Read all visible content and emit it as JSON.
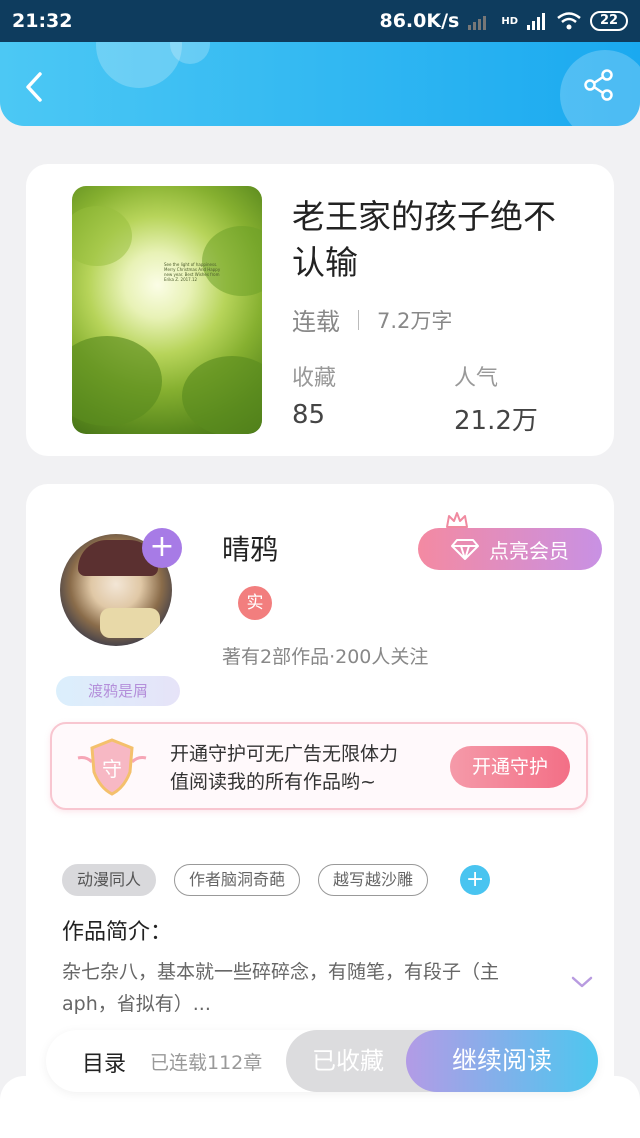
{
  "status_bar": {
    "time": "21:32",
    "network_speed": "86.0K/s",
    "network_type": "HD",
    "battery": "22",
    "icons": [
      "signal-icon",
      "wifi-icon",
      "battery-icon"
    ]
  },
  "header": {
    "back_icon": "back-arrow-icon",
    "share_icon": "share-icon",
    "accent_color": "#1aa9f0"
  },
  "book": {
    "title": "老王家的孩子绝不认输",
    "status": "连载",
    "word_count": "7.2万字",
    "collect_label": "收藏",
    "collect_value": "85",
    "popularity_label": "人气",
    "popularity_value": "21.2万",
    "cover_text": "See the light of happiness. Merry Christmas And Happy new year. Best Wishes from Erika Z. 2017.12"
  },
  "author": {
    "name": "晴鸦",
    "verified_label": "实",
    "stats": "著有2部作品·200人关注",
    "badge": "渡鸦是屑",
    "vip_label": "点亮会员"
  },
  "guard": {
    "icon_label": "守",
    "text_line1": "开通守护可无广告无限体力",
    "text_line2": "值阅读我的所有作品哟~",
    "button": "开通守护"
  },
  "tags": [
    "动漫同人",
    "作者脑洞奇葩",
    "越写越沙雕"
  ],
  "intro": {
    "title": "作品简介：",
    "text": "杂七杂八，基本就一些碎碎念，有随笔，有段子（主aph，省拟有）..."
  },
  "bottom_bar": {
    "toc_label": "目录",
    "chapters": "已连载112章",
    "collected_label": "已收藏",
    "read_label": "继续阅读"
  }
}
